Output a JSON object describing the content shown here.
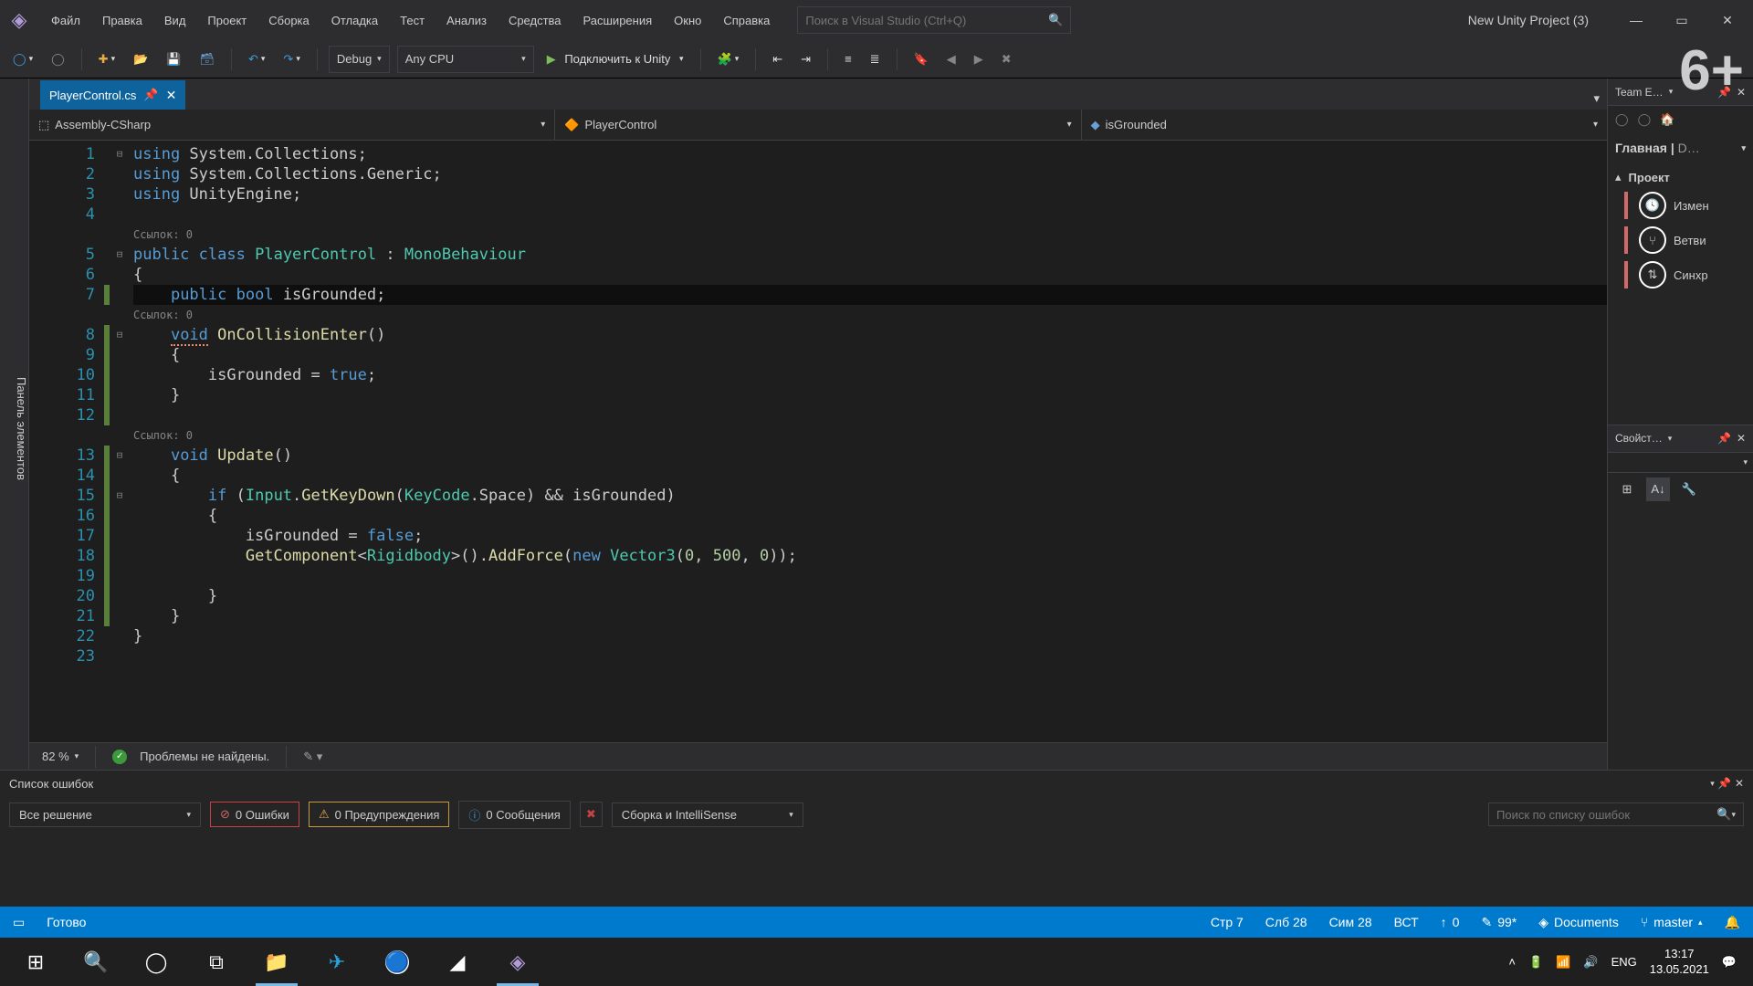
{
  "menu": {
    "items": [
      "Файл",
      "Правка",
      "Вид",
      "Проект",
      "Сборка",
      "Отладка",
      "Тест",
      "Анализ",
      "Средства",
      "Расширения",
      "Окно",
      "Справка"
    ]
  },
  "search": {
    "placeholder": "Поиск в Visual Studio (Ctrl+Q)"
  },
  "title": {
    "project": "New Unity Project (3)"
  },
  "age_rating": "6+",
  "toolbar": {
    "config": "Debug",
    "platform": "Any CPU",
    "attach": "Подключить к Unity"
  },
  "toolbox_strip": "Панель элементов",
  "tab": {
    "filename": "PlayerControl.cs"
  },
  "nav": {
    "scope": "Assembly-CSharp",
    "class": "PlayerControl",
    "member": "isGrounded"
  },
  "code_lines": [
    {
      "n": 1,
      "fold": "⊟",
      "html": "<span class='kw'>using</span> System.Collections;"
    },
    {
      "n": 2,
      "fold": "",
      "html": "<span class='kw'>using</span> System.Collections.Generic;"
    },
    {
      "n": 3,
      "fold": "",
      "html": "<span class='kw'>using</span> UnityEngine;"
    },
    {
      "n": 4,
      "fold": "",
      "html": ""
    },
    {
      "n": 0,
      "fold": "",
      "lens": "Ссылок: 0"
    },
    {
      "n": 5,
      "fold": "⊟",
      "html": "<span class='kw'>public</span> <span class='kw'>class</span> <span class='cls'>PlayerControl</span> : <span class='cls'>MonoBehaviour</span>"
    },
    {
      "n": 6,
      "fold": "",
      "html": "{"
    },
    {
      "n": 7,
      "fold": "",
      "mod": "g",
      "hl": true,
      "html": "    <span class='kw'>public</span> <span class='kw'>bool</span> isGrounded;"
    },
    {
      "n": 0,
      "fold": "",
      "lens": "    Ссылок: 0"
    },
    {
      "n": 8,
      "fold": "⊟",
      "mod": "g",
      "html": "    <span class='kw wavy'>void</span> <span class='mthd'>OnCollisionEnter</span>()"
    },
    {
      "n": 9,
      "fold": "",
      "mod": "g",
      "html": "    {"
    },
    {
      "n": 10,
      "fold": "",
      "mod": "g",
      "html": "        isGrounded = <span class='kw'>true</span>;"
    },
    {
      "n": 11,
      "fold": "",
      "mod": "g",
      "html": "    }"
    },
    {
      "n": 12,
      "fold": "",
      "mod": "g",
      "html": ""
    },
    {
      "n": 0,
      "fold": "",
      "lens": "    Ссылок: 0"
    },
    {
      "n": 13,
      "fold": "⊟",
      "mod": "g",
      "html": "    <span class='kw'>void</span> <span class='mthd'>Update</span>()"
    },
    {
      "n": 14,
      "fold": "",
      "mod": "g",
      "html": "    {"
    },
    {
      "n": 15,
      "fold": "⊟",
      "mod": "g",
      "html": "        <span class='kw'>if</span> (<span class='cls'>Input</span>.<span class='mthd'>GetKeyDown</span>(<span class='cls'>KeyCode</span>.Space) && isGrounded)"
    },
    {
      "n": 16,
      "fold": "",
      "mod": "g",
      "html": "        {"
    },
    {
      "n": 17,
      "fold": "",
      "mod": "g",
      "html": "            isGrounded = <span class='kw'>false</span>;"
    },
    {
      "n": 18,
      "fold": "",
      "mod": "g",
      "html": "            <span class='mthd'>GetComponent</span>&lt;<span class='cls'>Rigidbody</span>&gt;().<span class='mthd'>AddForce</span>(<span class='kw'>new</span> <span class='cls'>Vector3</span>(<span class='num'>0</span>, <span class='num'>500</span>, <span class='num'>0</span>));"
    },
    {
      "n": 19,
      "fold": "",
      "mod": "g",
      "html": ""
    },
    {
      "n": 20,
      "fold": "",
      "mod": "g",
      "html": "        }"
    },
    {
      "n": 21,
      "fold": "",
      "mod": "g",
      "html": "    }"
    },
    {
      "n": 22,
      "fold": "",
      "html": "}"
    },
    {
      "n": 23,
      "fold": "",
      "html": ""
    }
  ],
  "ed_status": {
    "zoom": "82 %",
    "no_issues": "Проблемы не найдены."
  },
  "team": {
    "title": "Team E…",
    "main": "Главная",
    "d": "D…",
    "project": "Проект",
    "items": [
      {
        "icon": "clock",
        "label": "Измен"
      },
      {
        "icon": "branch",
        "label": "Ветви"
      },
      {
        "icon": "sync",
        "label": "Синхр"
      }
    ]
  },
  "props": {
    "title": "Свойст…"
  },
  "errors": {
    "title": "Список ошибок",
    "filter": "Все решение",
    "errors": "0 Ошибки",
    "warnings": "0 Предупреждения",
    "messages": "0 Сообщения",
    "src": "Сборка и IntelliSense",
    "search": "Поиск по списку ошибок"
  },
  "statusbar": {
    "ready": "Готово",
    "line": "Стр 7",
    "col": "Слб 28",
    "char": "Сим 28",
    "ins": "ВСТ",
    "up": "0",
    "changes": "99*",
    "repo": "Documents",
    "branch": "master"
  },
  "tray": {
    "lang": "ENG",
    "time": "13:17",
    "date": "13.05.2021"
  }
}
